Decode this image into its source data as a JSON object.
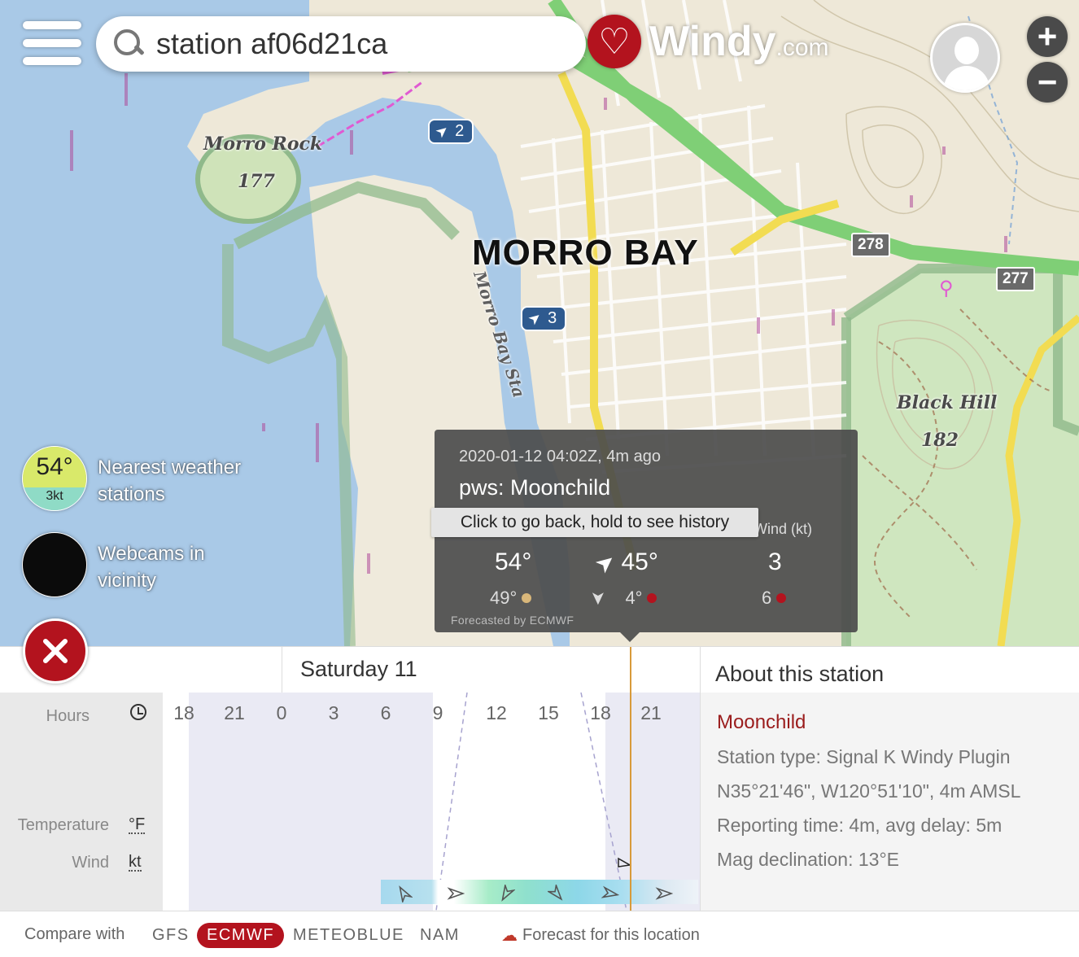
{
  "search": {
    "value": "station af06d21ca"
  },
  "brand": {
    "name": "Windy",
    "suffix": ".com"
  },
  "zoom": {
    "in_label": "+",
    "out_label": "−"
  },
  "map_labels": {
    "city": "MORRO BAY",
    "morro_rock": "Morro Rock",
    "morro_rock_elev": "177",
    "black_hill": "Black Hill",
    "black_hill_elev": "182",
    "road_278": "278",
    "road_277": "277",
    "state_park": "Morro Bay Sta"
  },
  "map_wind_markers": [
    {
      "value": "2"
    },
    {
      "value": "3"
    }
  ],
  "nearest": {
    "temp": "54°",
    "wind": "3kt",
    "label": "Nearest weather stations"
  },
  "webcams": {
    "label": "Webcams in vicinity"
  },
  "popup": {
    "time": "2020-01-12 04:02Z, 4m ago",
    "name": "pws: Moonchild",
    "tooltip": "Click to go back, hold to see history",
    "wind_header": "Wind (kt)",
    "temp": "54°",
    "dir": "45°",
    "wind": "3",
    "temp_fc": "49°",
    "dir_fc": "4°",
    "wind_fc": "6",
    "footer": "Forecasted by ECMWF",
    "colors": {
      "sun": "#d9b77a",
      "red": "#b3131e"
    }
  },
  "timeline": {
    "day": "Saturday 11",
    "rows": {
      "hours": "Hours",
      "temperature": "Temperature",
      "temperature_unit": "°F",
      "wind": "Wind",
      "wind_unit": "kt"
    },
    "hours": [
      "18",
      "21",
      "0",
      "3",
      "6",
      "9",
      "12",
      "15",
      "18",
      "21"
    ]
  },
  "about": {
    "title": "About this station",
    "name": "Moonchild",
    "type": "Station type: Signal K Windy Plugin",
    "coords": "N35°21'46\", W120°51'10\", 4m AMSL",
    "reporting": "Reporting time: 4m, avg delay: 5m",
    "mag": "Mag declination: 13°E"
  },
  "compare": {
    "label": "Compare with",
    "models": [
      "GFS",
      "ECMWF",
      "METEOBLUE",
      "NAM"
    ],
    "active": "ECMWF",
    "forecast_link": "Forecast for this location"
  },
  "colors": {
    "accent": "#b3131e",
    "water": "#a7c8e6",
    "park": "#d6e9c4"
  }
}
